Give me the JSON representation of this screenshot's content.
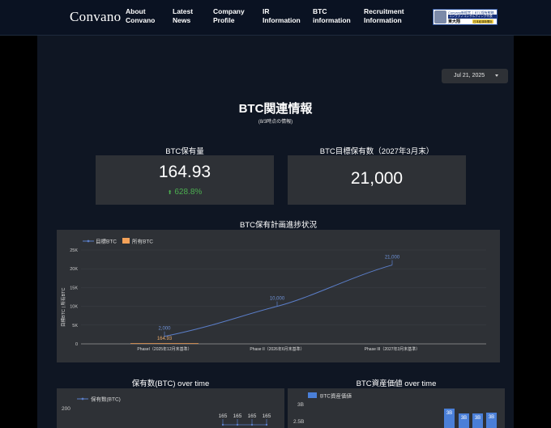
{
  "header": {
    "logo": "Convano",
    "nav": [
      {
        "line1": "About",
        "line2": "Convano"
      },
      {
        "line1": "Latest",
        "line2": "News"
      },
      {
        "line1": "Company",
        "line2": "Profile"
      },
      {
        "line1": "IR",
        "line2": "Information"
      },
      {
        "line1": "BTC",
        "line2": "information"
      },
      {
        "line1": "Recruitment",
        "line2": "Information"
      }
    ],
    "banner": {
      "line1": "Convano新經営 │ BTC保有戦略",
      "line2": "コンヴァノコンサルティング代表",
      "line3": "東大翔",
      "tag": "日本経済新聞社"
    }
  },
  "date_filter": "Jul 21, 2025",
  "page": {
    "title": "BTC関連情報",
    "subtitle": "(8/3時点の情報)"
  },
  "kpis": [
    {
      "label": "BTC保有量",
      "value": "164.93",
      "change": "628.8%",
      "change_direction": "up",
      "change_color": "#4caf50"
    },
    {
      "label": "BTC目標保有数（2027年3月末）",
      "value": "21,000"
    }
  ],
  "colors": {
    "target_line": "#5b7ec9",
    "holding_bar": "#f4a259",
    "btc_value_bar": "#4a7fd8",
    "panel": "#2e3136",
    "background": "#0f1623"
  },
  "charts": {
    "plan": {
      "title": "BTC保有計画進捗状況",
      "ylabel": "目標BTC | 所有BTC",
      "yticks": [
        "0",
        "5K",
        "10K",
        "15K",
        "20K",
        "25K"
      ],
      "legend": [
        "目標BTC",
        "所有BTC"
      ]
    },
    "holdings_over_time": {
      "title": "保有数(BTC) over time",
      "legend": [
        "保有数(BTC)"
      ],
      "ytick": "200",
      "labels": [
        "165",
        "165",
        "165",
        "165"
      ]
    },
    "asset_value": {
      "title": "BTC資産価値 over time",
      "legend": [
        "BTC資産価値"
      ],
      "yticks": [
        "3B",
        "2.5B"
      ],
      "labels": [
        "3B",
        "3B",
        "3B",
        "3B"
      ]
    }
  },
  "chart_data": [
    {
      "type": "line",
      "title": "BTC保有計画進捗状況",
      "ylabel": "目標BTC | 所有BTC",
      "categories": [
        "PhaseI（2025年12月末基準）",
        "Phase II（2026年6月末基準）",
        "Phase III（2027年3月末基準）"
      ],
      "ylim": [
        0,
        25000
      ],
      "series": [
        {
          "name": "目標BTC",
          "type": "line",
          "values": [
            2000,
            10000,
            21000
          ],
          "labels": [
            "2,000",
            "10,000",
            "21,000"
          ]
        },
        {
          "name": "所有BTC",
          "type": "bar",
          "values": [
            164.93,
            null,
            null
          ],
          "labels": [
            "164.93",
            "",
            ""
          ]
        }
      ],
      "grid": true,
      "legend": "top-left"
    },
    {
      "type": "line",
      "title": "保有数(BTC) over time",
      "series": [
        {
          "name": "保有数(BTC)",
          "values": [
            165,
            165,
            165,
            165
          ]
        }
      ]
    },
    {
      "type": "bar",
      "title": "BTC資産価値 over time",
      "series": [
        {
          "name": "BTC資産価値",
          "values": [
            "3B",
            "3B",
            "3B",
            "3B"
          ]
        }
      ]
    }
  ]
}
